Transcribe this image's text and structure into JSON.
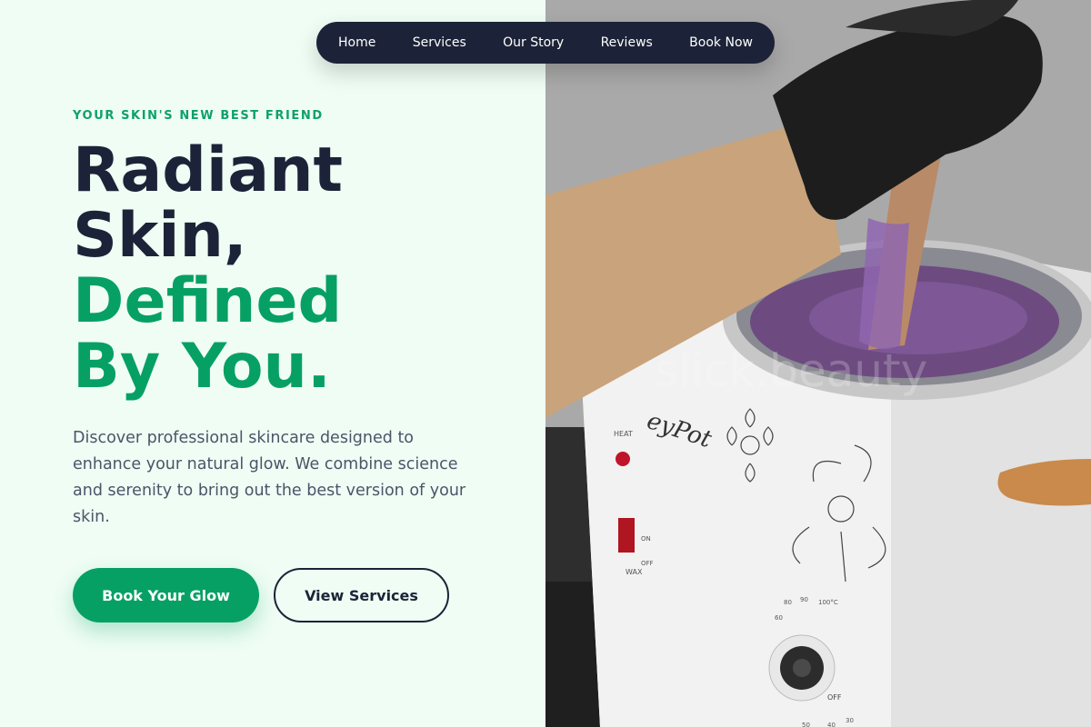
{
  "nav": {
    "items": [
      {
        "label": "Home"
      },
      {
        "label": "Services"
      },
      {
        "label": "Our Story"
      },
      {
        "label": "Reviews"
      },
      {
        "label": "Book Now"
      }
    ]
  },
  "hero": {
    "eyebrow": "YOUR SKIN'S NEW BEST FRIEND",
    "headline": {
      "line1": "Radiant",
      "line2": "Skin,",
      "line3": "Defined",
      "line4": "By You."
    },
    "description": "Discover professional skincare designed to enhance your natural glow. We combine science and serenity to bring out the best version of your skin.",
    "primary_cta": "Book Your Glow",
    "secondary_cta": "View Services"
  },
  "photo": {
    "watermark": "slick.beauty",
    "device_brand": "eyPot",
    "labels": {
      "heat": "HEAT",
      "on": "ON",
      "off": "OFF",
      "wax": "WAX",
      "dial_off": "OFF"
    },
    "dial_ticks": [
      "30",
      "40",
      "50",
      "60",
      "80",
      "90",
      "100°C"
    ]
  },
  "colors": {
    "accent": "#07a064",
    "dark": "#1c2338",
    "background": "#effdf4"
  }
}
